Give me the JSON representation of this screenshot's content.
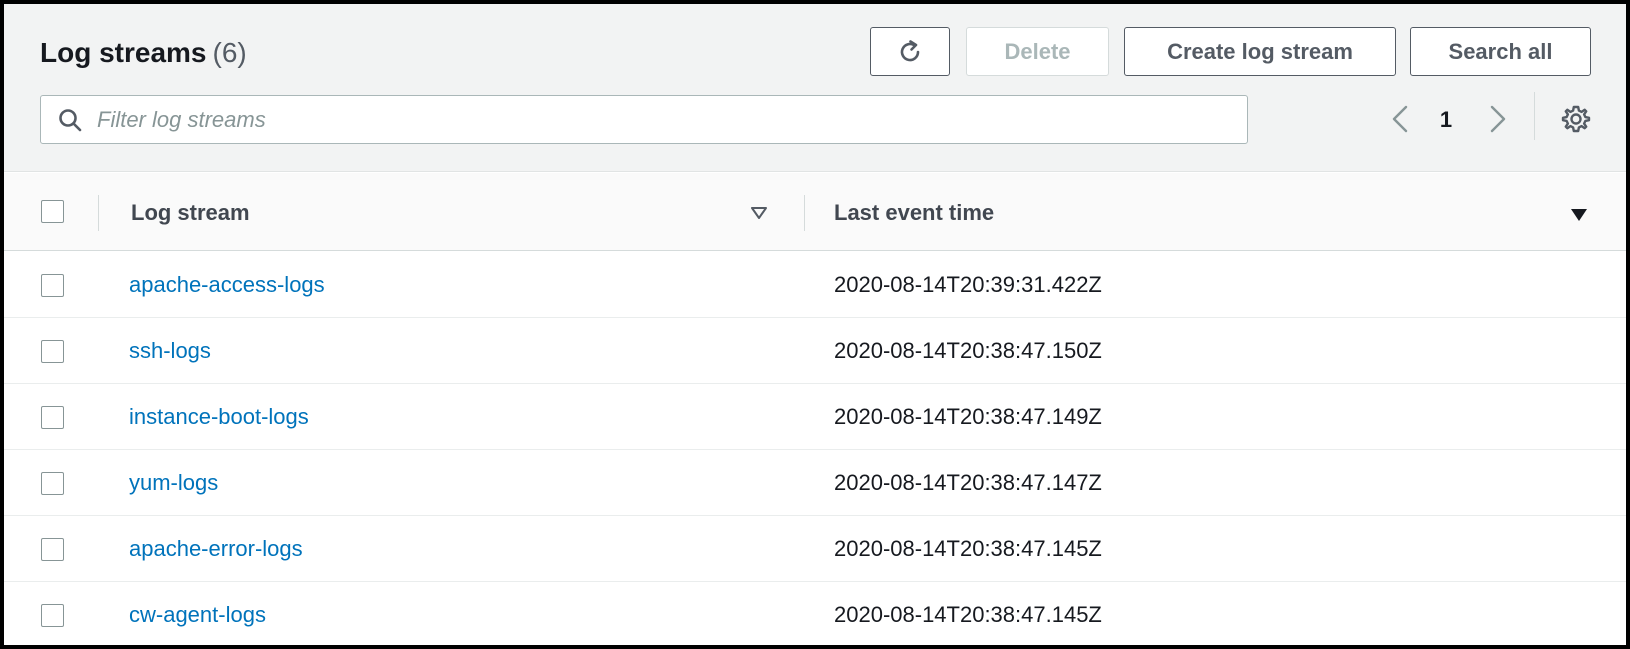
{
  "header": {
    "title": "Log streams",
    "count": "(6)",
    "buttons": {
      "delete": "Delete",
      "create": "Create log stream",
      "search_all": "Search all"
    },
    "filter": {
      "placeholder": "Filter log streams",
      "value": ""
    },
    "pagination": {
      "current_page": "1"
    }
  },
  "table": {
    "columns": {
      "log_stream": "Log stream",
      "last_event_time": "Last event time"
    },
    "rows": [
      {
        "name": "apache-access-logs",
        "time": "2020-08-14T20:39:31.422Z"
      },
      {
        "name": "ssh-logs",
        "time": "2020-08-14T20:38:47.150Z"
      },
      {
        "name": "instance-boot-logs",
        "time": "2020-08-14T20:38:47.149Z"
      },
      {
        "name": "yum-logs",
        "time": "2020-08-14T20:38:47.147Z"
      },
      {
        "name": "apache-error-logs",
        "time": "2020-08-14T20:38:47.145Z"
      },
      {
        "name": "cw-agent-logs",
        "time": "2020-08-14T20:38:47.145Z"
      }
    ]
  },
  "icons": [
    "refresh-icon",
    "search-icon",
    "chevron-left-icon",
    "chevron-right-icon",
    "gear-icon",
    "sort-descending-hollow-icon",
    "sort-descending-filled-icon"
  ],
  "colors": {
    "link": "#0073bb",
    "header_bg": "#f2f3f3",
    "text": "#16191f",
    "button_border": "#545b64",
    "disabled": "#aab7b8"
  }
}
